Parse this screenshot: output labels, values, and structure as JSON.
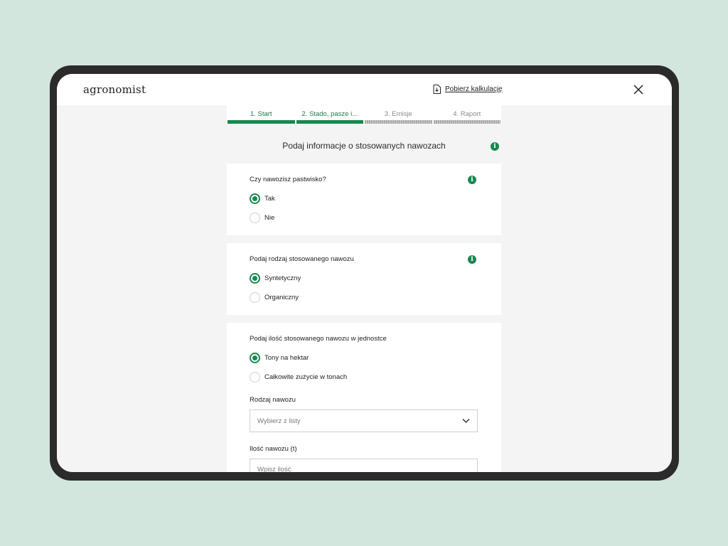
{
  "header": {
    "logo": "agronomist",
    "download_label": "Pobierz kalkulację"
  },
  "steps": [
    {
      "label": "1. Start",
      "status": "done"
    },
    {
      "label": "2. Stado, pasze i...",
      "status": "done"
    },
    {
      "label": "3. Emisje",
      "status": "todo"
    },
    {
      "label": "4. Raport",
      "status": "todo"
    }
  ],
  "page": {
    "heading": "Podaj informacje o stosowanych nawozach"
  },
  "q1": {
    "question": "Czy nawozisz pastwisko?",
    "options": [
      "Tak",
      "Nie"
    ],
    "selected": "Tak"
  },
  "q2": {
    "question": "Podaj rodzaj stosowanego nawozu",
    "options": [
      "Syntetyczny",
      "Organiczny"
    ],
    "selected": "Syntetyczny"
  },
  "q3": {
    "question": "Podaj ilość stosowanego nawozu w jednostce",
    "options": [
      "Tony na hektar",
      "Całkowite zużycie w tonach"
    ],
    "selected": "Tony na hektar",
    "type_label": "Rodzaj nawozu",
    "type_placeholder": "Wybierz z listy",
    "amount_label": "Ilość nawozu (t)",
    "amount_placeholder": "Wpisz ilość"
  },
  "icons": {
    "info_glyph": "i"
  },
  "colors": {
    "accent": "#16894f",
    "background": "#d2e6dd",
    "device": "#2b2b2b"
  }
}
